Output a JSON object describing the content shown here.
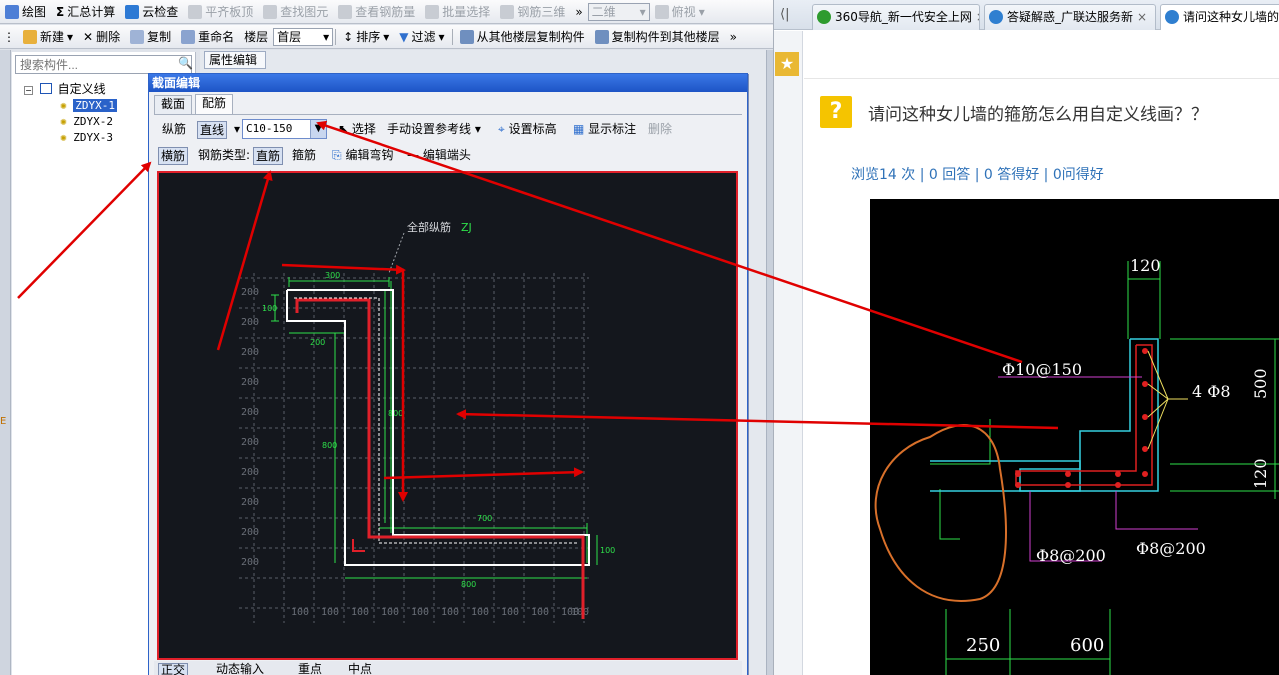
{
  "app": {
    "menu": [
      {
        "label": "绘图",
        "disabled": false
      },
      {
        "label": "汇总计算",
        "disabled": false
      },
      {
        "label": "云检查",
        "disabled": false
      },
      {
        "label": "平齐板顶",
        "disabled": true
      },
      {
        "label": "查找图元",
        "disabled": true
      },
      {
        "label": "查看钢筋量",
        "disabled": true
      },
      {
        "label": "批量选择",
        "disabled": true
      },
      {
        "label": "钢筋三维",
        "disabled": true
      }
    ],
    "view_2d": "二维",
    "view_top": "俯视",
    "toolbar2": {
      "new": "新建",
      "delete": "删除",
      "copy": "复制",
      "rename": "重命名",
      "floor_label": "楼层",
      "floor_value": "首层",
      "sort": "排序",
      "filter": "过滤",
      "copy_from": "从其他楼层复制构件",
      "copy_to": "复制构件到其他楼层"
    },
    "prop_tab": "属性编辑",
    "search_placeholder": "搜索构件...",
    "tree": {
      "root": "自定义线",
      "items": [
        "ZDYX-1",
        "ZDYX-2",
        "ZDYX-3"
      ]
    },
    "edge_letter": "E",
    "dialog": {
      "title": "截面编辑",
      "tabs": [
        "截面",
        "配筋"
      ],
      "row1": {
        "longitudinal": "纵筋",
        "line_mode": "直线",
        "rebar_spec": "C10-150",
        "select": "选择",
        "manual_ref": "手动设置参考线",
        "set_elevation": "设置标高",
        "show_label": "显示标注",
        "delete": "删除"
      },
      "row2": {
        "stirrup": "横筋",
        "rebar_type_label": "钢筋类型:",
        "straight": "直筋",
        "hoop": "箍筋",
        "edit_hook": "编辑弯钩",
        "edit_end": "编辑端头"
      },
      "canvas": {
        "all_long_label": "全部纵筋",
        "all_long_code": "ZJ",
        "dims": {
          "d300": "300",
          "d100a": "100",
          "d200": "200",
          "d800a": "800",
          "d800b": "800",
          "d700": "700",
          "d100b": "100",
          "d800c": "800"
        },
        "axis_left": [
          "200",
          "200",
          "200",
          "200",
          "200",
          "200",
          "200",
          "200",
          "200",
          "200"
        ],
        "axis_bottom": [
          "100",
          "100",
          "100",
          "100",
          "100",
          "100",
          "100",
          "100",
          "100",
          "100",
          "100"
        ]
      },
      "status": {
        "orthogonal": "正交",
        "dynamic_input": "动态输入",
        "snap_point": "重点",
        "mid_point": "中点"
      }
    }
  },
  "browser": {
    "tabs": [
      {
        "label": "360导航_新一代安全上网",
        "icon_color": "#2e9b2e",
        "active": false
      },
      {
        "label": "答疑解惑_广联达服务新",
        "icon_color": "#2f7fd0",
        "active": false
      },
      {
        "label": "请问这种女儿墙的箍筋",
        "icon_color": "#2f7fd0",
        "active": true
      }
    ],
    "question_title": "请问这种女儿墙的箍筋怎么用自定义线画？？",
    "stats": "浏览14 次 | 0 回答 | 0 答得好 | 0问得好",
    "cad": {
      "d120_top": "120",
      "hoop_label": "Φ10@150",
      "long_label": "4 Φ8",
      "d500": "500",
      "d120_right": "120",
      "bottom_label_1": "Φ8@200",
      "bottom_label_2": "Φ8@200",
      "d250": "250",
      "d600": "600"
    }
  },
  "colors": {
    "annotation_red": "#e00000",
    "cad_cyan": "#35d0e0",
    "cad_green": "#2ee04a",
    "cad_magenta": "#d040d0",
    "orange_circle": "#d8702a"
  }
}
